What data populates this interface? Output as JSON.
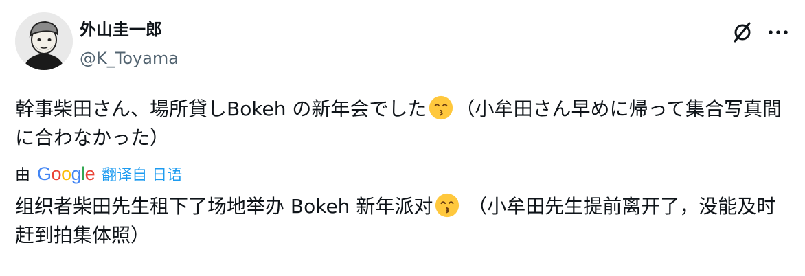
{
  "user": {
    "display_name": "外山圭一郎",
    "handle": "@K_Toyama"
  },
  "post": {
    "original_text_part1": "幹事柴田さん、場所貸しBokeh の新年会でした",
    "original_text_part2": "（小牟田さん早めに帰って集合写真間に合わなかった）",
    "translated_text_part1": "组织者柴田先生租下了场地举办 Bokeh 新年派对",
    "translated_text_part2": " （小牟田先生提前离开了，没能及时赶到拍集体照）"
  },
  "translation": {
    "by_prefix": "由",
    "provider_letters": [
      "G",
      "o",
      "o",
      "g",
      "l",
      "e"
    ],
    "link_text": "翻译自 日语"
  },
  "icons": {
    "grok": "grok-slash-icon",
    "more": "more-horizontal-icon",
    "emoji": "kissing-face-smiling-eyes-emoji"
  },
  "colors": {
    "text": "#0f1419",
    "secondary": "#536471",
    "link": "#1d9bf0"
  }
}
